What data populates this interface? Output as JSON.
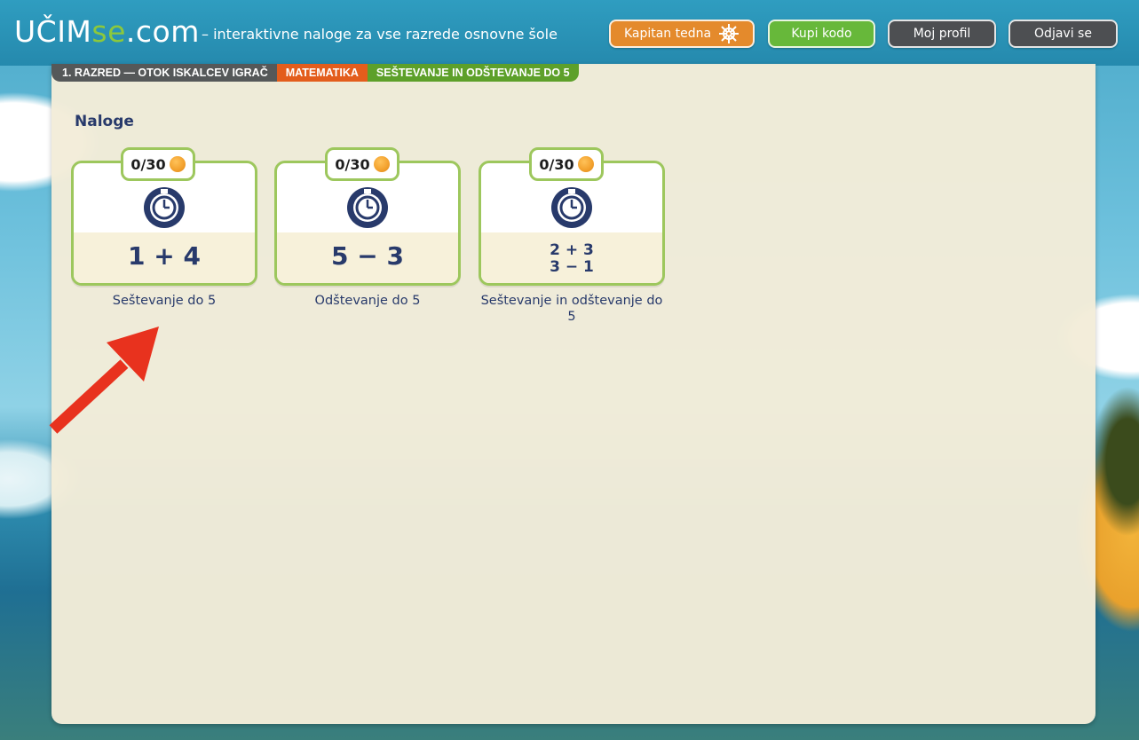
{
  "header": {
    "logo": {
      "part1": "UČIM",
      "part2": "se",
      "part3": ".com"
    },
    "tagline": "–  interaktivne naloge za vse razrede osnovne šole",
    "buttons": {
      "captain": "Kapitan tedna",
      "buy": "Kupi kodo",
      "profile": "Moj profil",
      "logout": "Odjavi se"
    }
  },
  "breadcrumb": [
    "1. RAZRED — OTOK ISKALCEV IGRAČ",
    "MATEMATIKA",
    "SEŠTEVANJE IN ODŠTEVANJE DO 5"
  ],
  "section_title": "Naloge",
  "tasks": [
    {
      "score": "0/30",
      "expr_lines": [
        "1 + 4"
      ],
      "label": "Seštevanje do 5"
    },
    {
      "score": "0/30",
      "expr_lines": [
        "5 − 3"
      ],
      "label": "Odštevanje do 5"
    },
    {
      "score": "0/30",
      "expr_lines": [
        "2 + 3",
        "3 − 1"
      ],
      "label": "Seštevanje in odštevanje do 5"
    }
  ],
  "colors": {
    "header": "#2589ad",
    "captain_button": "#e48a2c",
    "buy_button": "#67b83a",
    "profile_button": "#4d4f52",
    "card_border": "#9dc75d",
    "text_navy": "#283a6b",
    "arrow": "#e8321e"
  },
  "icons": [
    "ship-wheel-icon",
    "stopwatch-icon",
    "coin-icon",
    "arrow-pointer"
  ]
}
